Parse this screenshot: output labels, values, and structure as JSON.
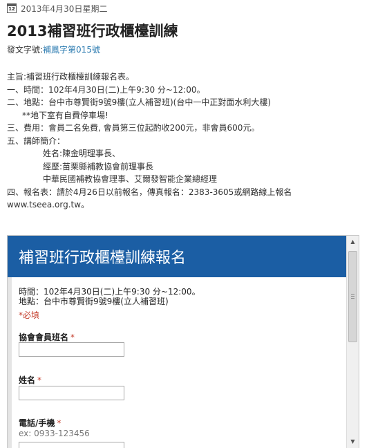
{
  "post": {
    "date_icon_number": "12",
    "date": "2013年4月30日星期二",
    "title": "2013補習班行政櫃檯訓練",
    "doc_number_label": "發文字號:",
    "doc_number_link": "補鳳字第015號"
  },
  "body_lines": [
    "主旨:補習班行政櫃檯訓練報名表。",
    "一、時間：102年4月30日(二)上午9:30 分~12:00。",
    "二、地點：台中市尊賢街9號9樓(立人補習班)(台中一中正對面水利大樓)",
    "**地下室有自費停車場!",
    "三、費用：會員二名免費, 會員第三位起酌收200元，非會員600元。",
    "五、講師簡介：",
    "姓名:陳金明理事長、",
    "經歷:苗栗縣補教協會前理事長",
    "中華民國補教協會理事、艾爾發智能企業總經理",
    "四、報名表：請於4月26日以前報名，傳真報名：2383-3605或網路線上報名",
    "www.tseea.org.tw。"
  ],
  "form": {
    "title": "補習班行政櫃檯訓練報名",
    "desc_time": "時間：102年4月30日(二)上午9:30 分~12:00。",
    "desc_place": "地點：台中市尊賢街9號9樓(立人補習班)",
    "required_note": "*必填",
    "fields": [
      {
        "label": "協會會員班名",
        "required_mark": "*"
      },
      {
        "label": "姓名",
        "required_mark": "*"
      },
      {
        "label": "電話/手機",
        "required_mark": "*",
        "help": "ex: 0933-123456"
      }
    ]
  },
  "colors": {
    "form_header_bg": "#1b5ea4",
    "link": "#2a7ab0",
    "required": "#c43c2a"
  },
  "icons": {
    "date_icon": "calendar-icon",
    "scroll_up": "arrow-up-icon",
    "scroll_down": "arrow-down-icon"
  }
}
